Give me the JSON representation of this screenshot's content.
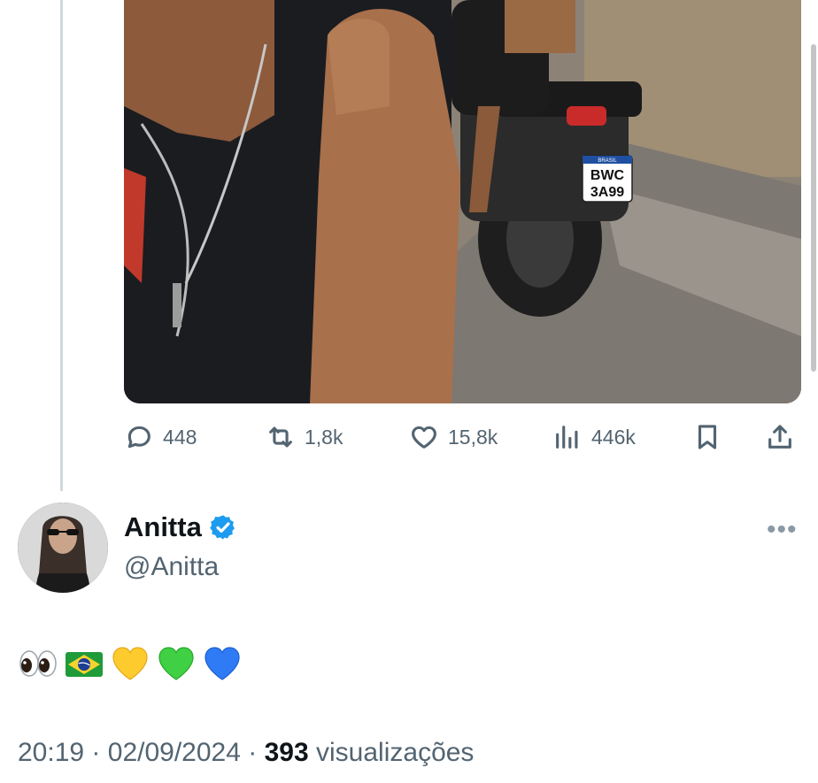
{
  "tweet_actions": {
    "replies": "448",
    "retweets": "1,8k",
    "likes": "15,8k",
    "views": "446k"
  },
  "photo": {
    "license_plate_top": "BRASIL",
    "license_plate_line1": "BWC",
    "license_plate_line2": "3A99"
  },
  "author": {
    "name": "Anitta",
    "handle": "@Anitta",
    "verified": true,
    "accent_color": "#1d9bf0"
  },
  "tweet": {
    "emojis": [
      "eyes",
      "brazil-flag",
      "yellow-heart",
      "green-heart",
      "blue-heart"
    ]
  },
  "meta": {
    "time": "20:19",
    "separator": "·",
    "date": "02/09/2024",
    "views_count": "393",
    "views_label": "visualizações"
  }
}
